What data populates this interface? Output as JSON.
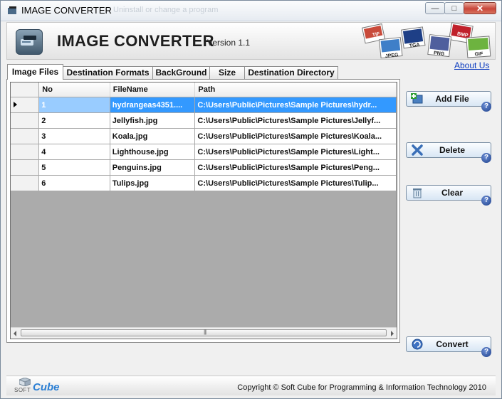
{
  "window": {
    "title": "IMAGE CONVERTER",
    "ghost_text": "Uninstall or change a program"
  },
  "banner": {
    "brand": "IMAGE CONVERTER",
    "version": "Version 1.1",
    "formats": [
      "TIF",
      "BMP",
      "TGA",
      "JPEG",
      "PNG",
      "GIF"
    ]
  },
  "about_link": "About Us",
  "tabs": [
    {
      "label": "Image Files",
      "active": true
    },
    {
      "label": "Destination Formats",
      "active": false
    },
    {
      "label": "BackGround",
      "active": false
    },
    {
      "label": "Size",
      "active": false
    },
    {
      "label": "Destination Directory",
      "active": false
    }
  ],
  "grid": {
    "columns": [
      "No",
      "FileName",
      "Path"
    ],
    "rows": [
      {
        "no": "1",
        "filename": "hydrangeas4351....",
        "path": "C:\\Users\\Public\\Pictures\\Sample Pictures\\hydr...",
        "selected": true
      },
      {
        "no": "2",
        "filename": "Jellyfish.jpg",
        "path": "C:\\Users\\Public\\Pictures\\Sample Pictures\\Jellyf..."
      },
      {
        "no": "3",
        "filename": "Koala.jpg",
        "path": "C:\\Users\\Public\\Pictures\\Sample Pictures\\Koala..."
      },
      {
        "no": "4",
        "filename": "Lighthouse.jpg",
        "path": "C:\\Users\\Public\\Pictures\\Sample Pictures\\Light..."
      },
      {
        "no": "5",
        "filename": "Penguins.jpg",
        "path": "C:\\Users\\Public\\Pictures\\Sample Pictures\\Peng..."
      },
      {
        "no": "6",
        "filename": "Tulips.jpg",
        "path": "C:\\Users\\Public\\Pictures\\Sample Pictures\\Tulip..."
      }
    ]
  },
  "actions": {
    "add_file": "Add File",
    "delete": "Delete",
    "clear": "Clear",
    "convert": "Convert",
    "help_glyph": "?"
  },
  "footer": {
    "logo_soft": "SOFT",
    "logo_cube": "Cube",
    "copyright": "Copyright © Soft Cube for Programming & Information Technology 2010"
  },
  "colors": {
    "selection": "#3399ff",
    "link": "#0b3bbf",
    "accent_help": "#1d3f8a"
  }
}
